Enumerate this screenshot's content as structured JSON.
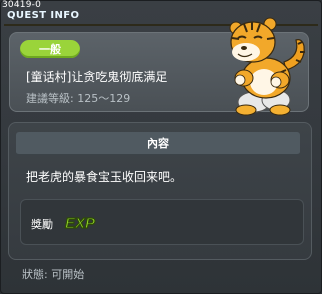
{
  "header": {
    "quest_id": "30419-0",
    "title": "QUEST INFO"
  },
  "quest": {
    "category": "一般",
    "name": "[童话村]让贪吃鬼彻底满足",
    "level_range": "建議等級: 125～129",
    "npc_icon": "tiger-npc-portrait"
  },
  "content": {
    "header": "內容",
    "description": "把老虎的暴食宝玉收回来吧。"
  },
  "reward": {
    "label": "獎勵",
    "icon": "exp-icon",
    "icon_text": "EXP"
  },
  "status": "狀態: 可開始",
  "colors": {
    "badge_green": "#9ad43a",
    "exp_green": "#9be12c",
    "title_text": "#e8f6ff"
  }
}
